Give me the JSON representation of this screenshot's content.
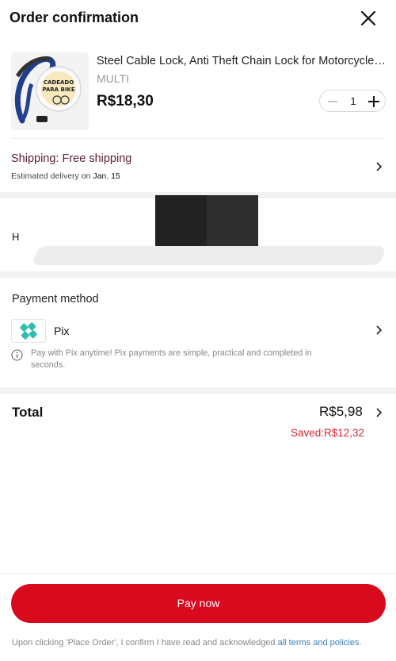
{
  "header": {
    "title": "Order confirmation"
  },
  "product": {
    "name": "Steel Cable Lock, Anti Theft Chain Lock for Motorcycle ...",
    "variant": "MULTI",
    "price": "R$18,30",
    "quantity": "1",
    "image_caption": "CADEADO PARA BIKE"
  },
  "shipping": {
    "title": "Shipping: Free shipping",
    "delivery_prefix": "Estimated delivery on",
    "delivery_date": "Jan. 15"
  },
  "address": {
    "visible_letter": "H"
  },
  "payment": {
    "title": "Payment method",
    "method": "Pix",
    "info": "Pay with Pix anytime! Pix payments are simple, practical and completed in seconds.",
    "pix_color": "#32bcad"
  },
  "total": {
    "label": "Total",
    "value": "R$5,98",
    "saved": "Saved:R$12,32"
  },
  "footer": {
    "pay_button": "Pay now",
    "terms_prefix": "Upon clicking 'Place Order', I confirm I have read and acknowledged ",
    "terms_link": "all terms and policies."
  },
  "colors": {
    "accent": "#d90a1e",
    "saved": "#d8262f",
    "shipping_title": "#5c1e30",
    "link": "#3a82b8"
  },
  "icons": [
    "close-icon",
    "minus-icon",
    "plus-icon",
    "chevron-right-icon",
    "pix-icon",
    "info-icon"
  ]
}
